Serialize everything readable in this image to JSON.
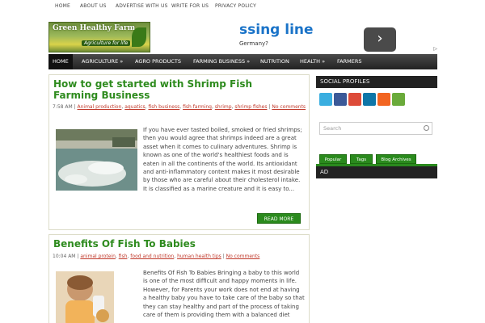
{
  "topnav": [
    "HOME",
    "ABOUT US",
    "ADVERTISE WITH US",
    "WRITE FOR US",
    "PRIVACY POLICY"
  ],
  "logo": {
    "title": "Green Healthy Farm",
    "tagline": "Agriculture for life"
  },
  "ad": {
    "headline": "ssing line",
    "sub": "Germany?",
    "button": "›"
  },
  "mainnav": [
    "HOME",
    "AGRICULTURE »",
    "AGRO PRODUCTS",
    "FARMING BUSINESS »",
    "NUTRITION",
    "HEALTH »",
    "FARMERS"
  ],
  "posts": [
    {
      "title": "How to get started with Shrimp Fish Farming Business",
      "time": "7:58 AM",
      "tags": [
        "Animal production",
        "aquatics",
        "fish business",
        "fish farming",
        "shrimp",
        "shrimp fishes",
        "No comments"
      ],
      "excerpt": "If you have ever tasted boiled, smoked or fried shrimps; then you would agree that shrimps indeed are a great asset when it comes to culinary adventures. Shrimp is known as one of the world's healthiest foods and is eaten in all the continents of the world.  Its antioxidant and anti-inflammatory content makes it most desirable by those who are careful about their cholesterol intake. It is classified as a marine creature and it is easy to...",
      "read_more": "READ MORE"
    },
    {
      "title": "Benefits Of Fish To Babies",
      "time": "10:04 AM",
      "tags": [
        "animal protein",
        "fish",
        "food and nutrition",
        "human health tips",
        "No comments"
      ],
      "excerpt": "Benefits Of Fish To Babies Bringing a baby to this world is one of the most difficult and happy moments in life. However, for Parents your work does not end at having a healthy baby you have to take care of the baby so that they can stay healthy and part of the process of taking care of them is providing them with a balanced diet"
    }
  ],
  "sidebar": {
    "social_title": "SOCIAL PROFILES",
    "social_icons": [
      "twitter-icon",
      "facebook-icon",
      "google-plus-icon",
      "linkedin-icon",
      "rss-icon",
      "email-icon"
    ],
    "search_placeholder": "Search",
    "tabs": [
      "Popular",
      "Tags",
      "Blog Archives"
    ],
    "ad_title": "AD"
  },
  "colors": {
    "accent": "#2a8a1d",
    "title": "#2e8b1e",
    "tag": "#c0392b",
    "nav": "#222222"
  }
}
